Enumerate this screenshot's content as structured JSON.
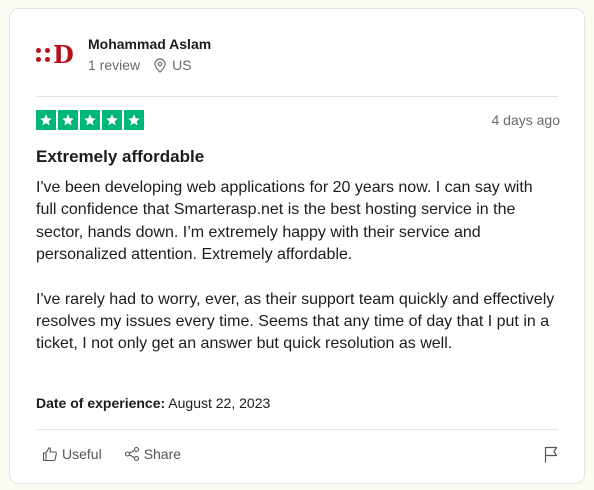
{
  "reviewer": {
    "logo_letter": "D",
    "name": "Mohammad Aslam",
    "review_count": "1 review",
    "location": "US"
  },
  "review": {
    "rating": 5,
    "date_ago": "4 days ago",
    "title": "Extremely affordable",
    "paragraphs": [
      "I've been developing web applications for 20 years now. I can say with full confidence that Smarterasp.net is the best hosting service in the sector, hands down. I’m extremely happy with their service and personalized attention. Extremely affordable.",
      "I've rarely had to worry, ever, as their support team quickly and effectively resolves my issues every time. Seems that any time of day that I put in a ticket, I not only get an answer but quick resolution as well."
    ],
    "experience_label": "Date of experience:",
    "experience_date": "August 22, 2023"
  },
  "actions": {
    "useful_label": "Useful",
    "share_label": "Share"
  },
  "colors": {
    "star_green": "#00b67a",
    "logo_red": "#b5111b"
  },
  "icons": [
    "location-pin-icon",
    "star-icon",
    "thumbs-up-icon",
    "share-icon",
    "flag-icon"
  ]
}
